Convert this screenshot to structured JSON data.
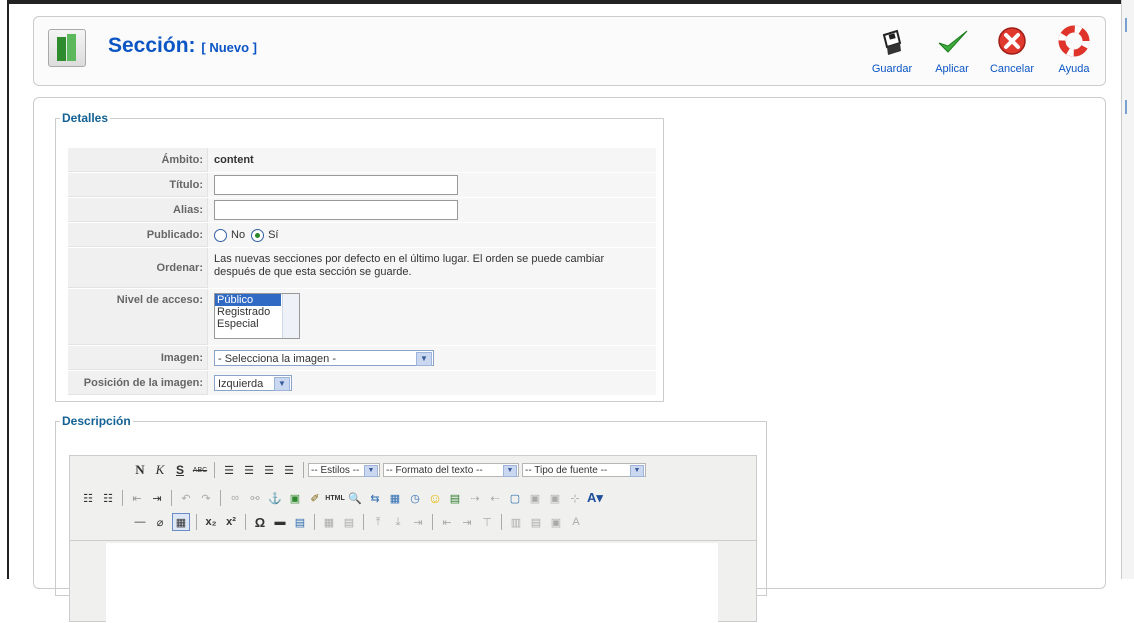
{
  "header": {
    "title": "Sección:",
    "subtitle": "[ Nuevo ]"
  },
  "toolbar": {
    "save": "Guardar",
    "apply": "Aplicar",
    "cancel": "Cancelar",
    "help": "Ayuda"
  },
  "details": {
    "legend": "Detalles",
    "scope_label": "Ámbito:",
    "scope_value": "content",
    "title_label": "Título:",
    "title_value": "",
    "alias_label": "Alias:",
    "alias_value": "",
    "published_label": "Publicado:",
    "published_no": "No",
    "published_yes": "Sí",
    "published_selected": "Sí",
    "order_label": "Ordenar:",
    "order_text_1": "Las nuevas secciones por defecto en el último lugar. El orden se puede cambiar",
    "order_text_2": "después de que esta sección se guarde.",
    "access_label": "Nivel de acceso:",
    "access_options": [
      "Público",
      "Registrado",
      "Especial"
    ],
    "access_selected": "Público",
    "image_label": "Imagen:",
    "image_value": "- Selecciona la imagen -",
    "image_pos_label": "Posición de la imagen:",
    "image_pos_value": "Izquierda"
  },
  "description": {
    "legend": "Descripción",
    "styles": "-- Estilos --",
    "format": "-- Formato del texto --",
    "font": "-- Tipo de fuente --"
  }
}
